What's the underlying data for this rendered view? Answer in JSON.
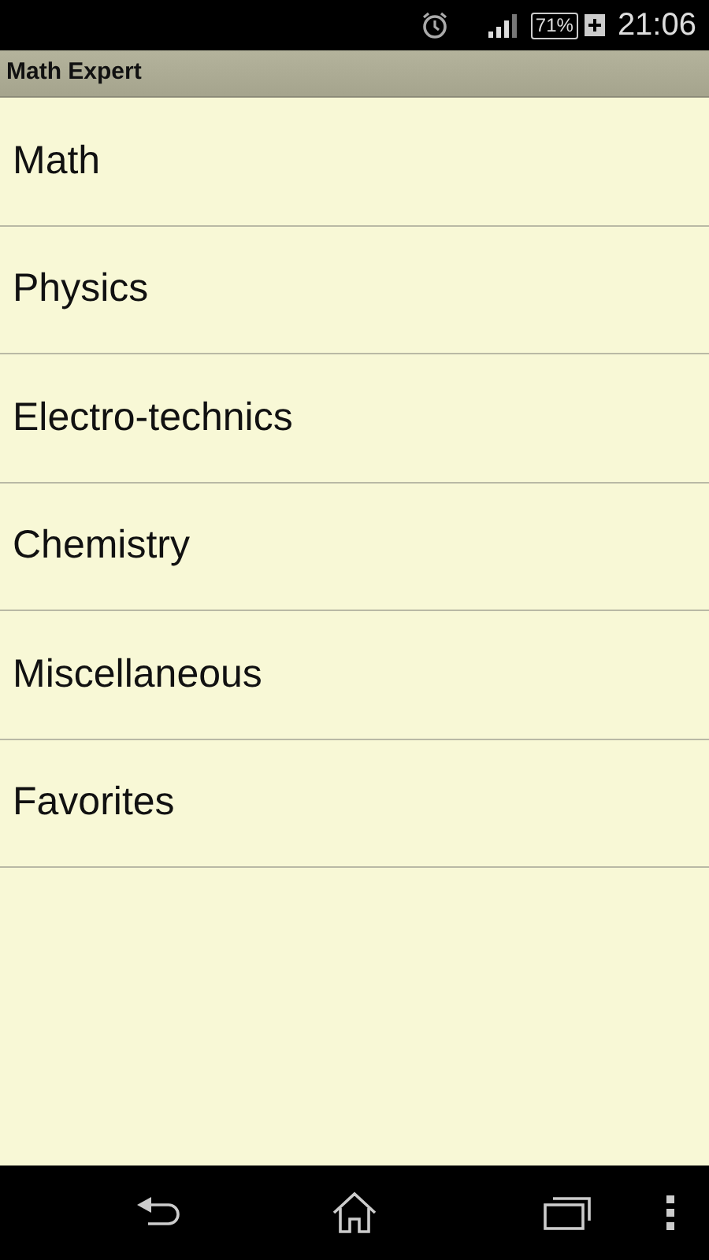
{
  "status_bar": {
    "battery": "71%",
    "time": "21:06"
  },
  "title_bar": {
    "title": "Math Expert"
  },
  "menu": [
    {
      "label": "Math"
    },
    {
      "label": "Physics"
    },
    {
      "label": "Electro-technics"
    },
    {
      "label": "Chemistry"
    },
    {
      "label": "Miscellaneous"
    },
    {
      "label": "Favorites"
    }
  ]
}
